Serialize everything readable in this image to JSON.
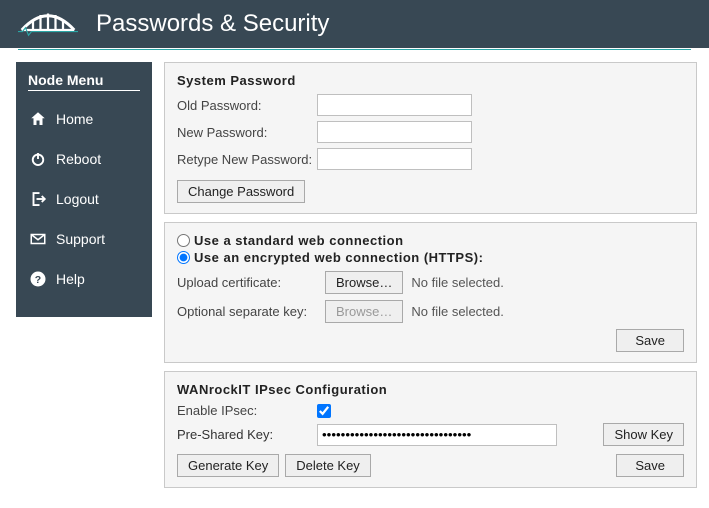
{
  "header": {
    "title": "Passwords & Security"
  },
  "sidebar": {
    "title": "Node Menu",
    "items": [
      {
        "label": "Home"
      },
      {
        "label": "Reboot"
      },
      {
        "label": "Logout"
      },
      {
        "label": "Support"
      },
      {
        "label": "Help"
      }
    ]
  },
  "system_password": {
    "heading": "System Password",
    "old_label": "Old Password:",
    "new_label": "New Password:",
    "retype_label": "Retype New Password:",
    "old_value": "",
    "new_value": "",
    "retype_value": "",
    "change_button": "Change Password"
  },
  "web_connection": {
    "option_standard": "Use a standard web connection",
    "option_encrypted": "Use an encrypted web connection (HTTPS):",
    "selected": "encrypted",
    "upload_cert_label": "Upload certificate:",
    "optional_key_label": "Optional separate key:",
    "browse_button": "Browse…",
    "no_file": "No file selected.",
    "save_button": "Save"
  },
  "ipsec": {
    "heading": "WANrockIT IPsec Configuration",
    "enable_label": "Enable IPsec:",
    "enabled": true,
    "psk_label": "Pre-Shared Key:",
    "psk_value": "••••••••••••••••••••••••••••••••",
    "show_key_button": "Show Key",
    "generate_button": "Generate Key",
    "delete_button": "Delete Key",
    "save_button": "Save"
  }
}
